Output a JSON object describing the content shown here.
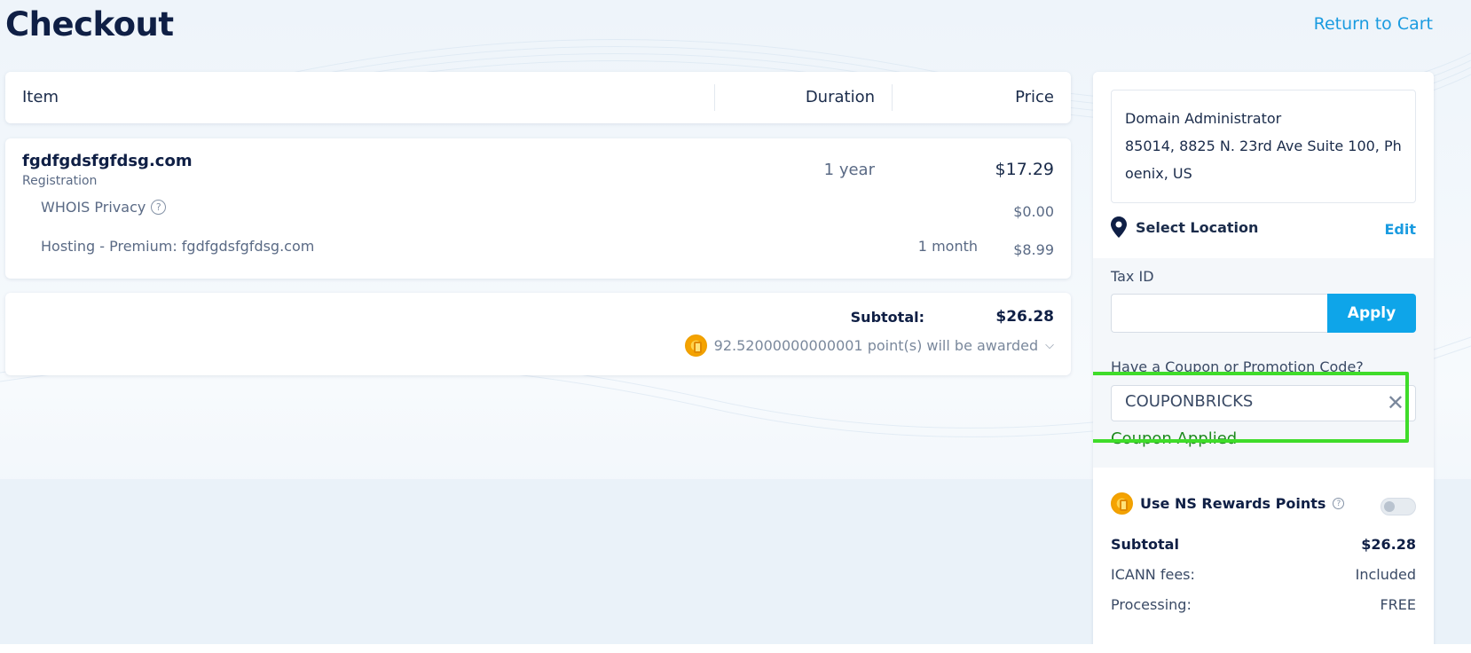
{
  "page": {
    "title": "Checkout",
    "return_link": "Return to Cart"
  },
  "table": {
    "headers": {
      "item": "Item",
      "duration": "Duration",
      "price": "Price"
    }
  },
  "items": {
    "domain": {
      "name": "fgdfgdsfgfdsg.com",
      "type": "Registration",
      "duration": "1 year",
      "price": "$17.29"
    },
    "whois": {
      "label": "WHOIS Privacy",
      "price": "$0.00"
    },
    "hosting": {
      "label": "Hosting - Premium: fgdfgdsfgfdsg.com",
      "duration": "1 month",
      "price": "$8.99"
    }
  },
  "summary": {
    "subtotal_label": "Subtotal:",
    "subtotal_value": "$26.28",
    "points_text": "92.52000000000001 point(s) will be awarded"
  },
  "sidebar": {
    "address": {
      "name": "Domain Administrator",
      "line1": "85014, 8825 N. 23rd Ave Suite 100, Ph",
      "line2": "oenix, US"
    },
    "location_label": "Select Location",
    "edit_label": "Edit",
    "tax_label": "Tax ID",
    "tax_value": "",
    "apply_label": "Apply",
    "coupon_label": "Have a Coupon or Promotion Code?",
    "coupon_value": "COUPONBRICKS",
    "coupon_status": "Coupon Applied",
    "rewards_label": "Use NS Rewards Points",
    "rewards_enabled": false,
    "subtotal_label": "Subtotal",
    "subtotal_value": "$26.28",
    "icann_label": "ICANN fees:",
    "icann_value": "Included",
    "processing_label": "Processing:",
    "processing_value": "FREE"
  },
  "colors": {
    "accent": "#0ea5e9",
    "link": "#1a9be0",
    "success": "#1e8a1e",
    "highlight": "#3fdc2a",
    "heading": "#0f1f45"
  }
}
